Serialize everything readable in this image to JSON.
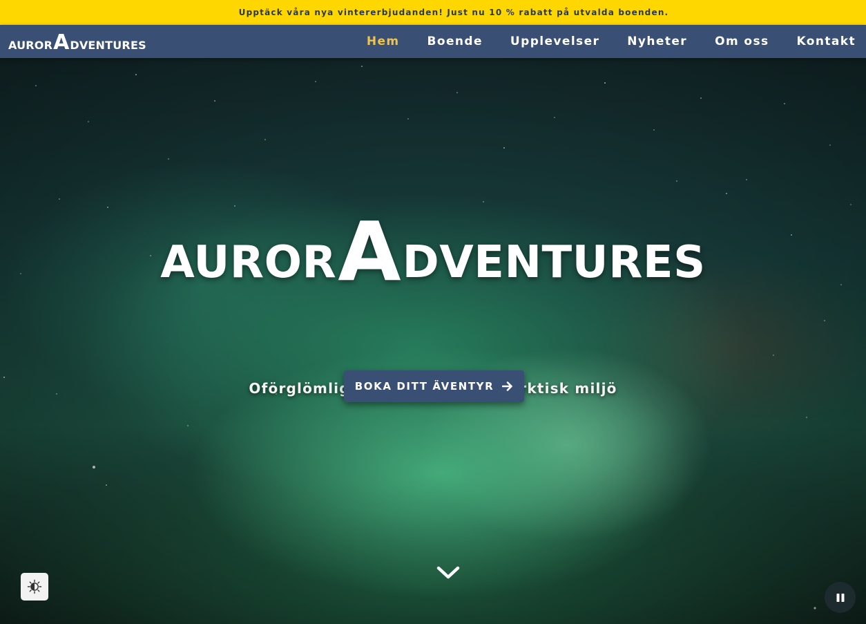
{
  "promo": {
    "text": "Upptäck våra nya vintererbjudanden! Just nu 10 % rabatt på utvalda boenden."
  },
  "brand": {
    "prefix": "AUROR",
    "big_letter": "A",
    "suffix": "DVENTURES"
  },
  "nav": {
    "items": [
      {
        "label": "Hem",
        "active": true
      },
      {
        "label": "Boende",
        "active": false
      },
      {
        "label": "Upplevelser",
        "active": false
      },
      {
        "label": "Nyheter",
        "active": false
      },
      {
        "label": "Om oss",
        "active": false
      },
      {
        "label": "Kontakt",
        "active": false
      }
    ]
  },
  "hero": {
    "tagline": "Oförglömliga upplevelser i en arktisk miljö",
    "cta_label": "BOKA DITT ÄVENTYR",
    "cta_icon": "arrow-right-icon",
    "scroll_icon": "chevron-down-icon"
  },
  "controls": {
    "contrast_icon": "contrast-icon",
    "pause_icon": "pause-icon"
  },
  "colors": {
    "promo_bg": "#ffd700",
    "nav_bg": "#3a4f74",
    "nav_active": "#f0c44a",
    "cta_bg": "#3a4f74"
  }
}
